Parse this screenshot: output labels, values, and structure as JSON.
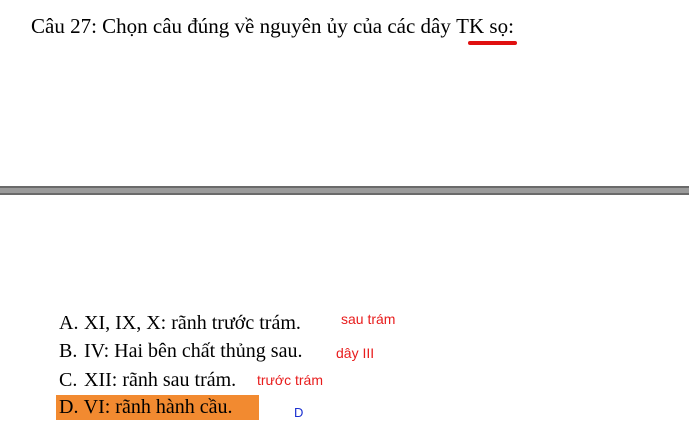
{
  "question": {
    "prefix": "Câu 27: Chọn câu đúng về nguyên ủy của các dây ",
    "underlined": "TK",
    "suffix": " sọ:"
  },
  "options": [
    {
      "letter": "A.",
      "text": "XI, IX, X: rãnh trước trám.",
      "note": "sau trám"
    },
    {
      "letter": "B.",
      "text": "IV: Hai bên chất thủng sau.",
      "note": "dây III"
    },
    {
      "letter": "C.",
      "text": "XII: rãnh sau trám.",
      "note": "trước trám"
    },
    {
      "letter": "D.",
      "text": "VI: rãnh hành cầu.",
      "note": "D"
    }
  ],
  "colors": {
    "annotation": "#e81c1c",
    "answer_mark": "#1a2fd0",
    "selected_highlight": "#f28a30",
    "divider": "#9a9a9a"
  }
}
